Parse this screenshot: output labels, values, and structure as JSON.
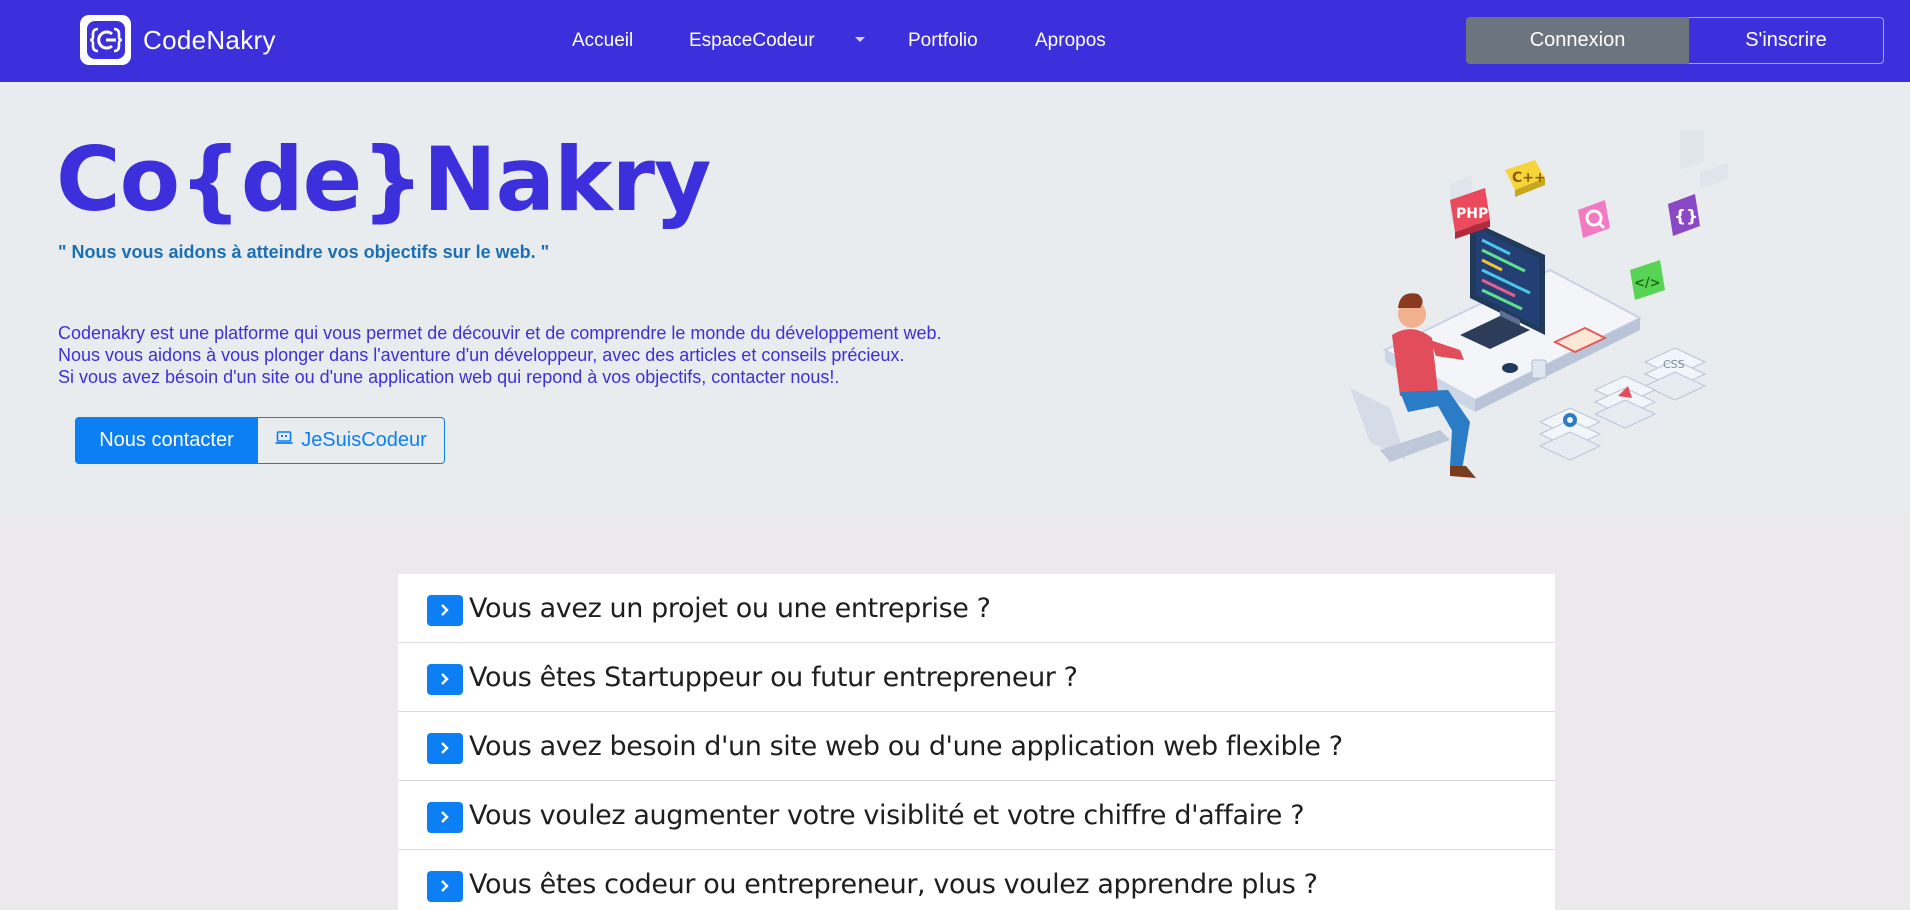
{
  "navbar": {
    "brand": "CodeNakry",
    "links": [
      "Accueil",
      "EspaceCodeur",
      "Portfolio",
      "Apropos"
    ],
    "login": "Connexion",
    "signup": "S'inscrire"
  },
  "hero": {
    "title": "Co{de}Nakry",
    "tagline": "\" Nous vous aidons à atteindre vos objectifs sur le web. \"",
    "desc": [
      "Codenakry est une platforme qui vous permet de découvir et de comprendre le monde du développement web.",
      "Nous vous aidons à vous plonger dans l'aventure d'un développeur, avec des articles et conseils précieux.",
      "Si vous avez bésoin d'un site ou d'une application web qui repond à vos objectifs, contacter nous!."
    ],
    "contact_button": "Nous contacter",
    "coder_button": "JeSuisCodeur",
    "illustration_badges": [
      "C++",
      "PHP",
      "{}",
      "</>",
      "CSS"
    ]
  },
  "faq": [
    "Vous avez un projet ou une entreprise ?",
    "Vous êtes Startuppeur ou futur entrepreneur ?",
    "Vous avez besoin d'un site web ou d'une application web flexible ?",
    "Vous voulez augmenter votre visiblité et votre chiffre d'affaire ?",
    "Vous êtes codeur ou entrepreneur, vous voulez apprendre plus ?"
  ],
  "colors": {
    "primary": "#3c2fdc",
    "accent": "#0d7ff5",
    "hero_bg": "#e9ecef",
    "secondary": "#6c757d"
  }
}
